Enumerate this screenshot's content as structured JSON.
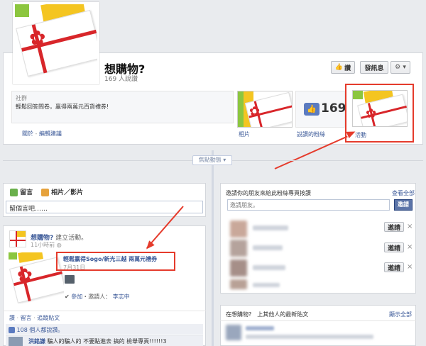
{
  "page": {
    "name": "想購物?",
    "likes_text": "169 人說讚",
    "category": "社群",
    "description": "輕鬆回答問卷，贏得兩萬元百貨禮券!",
    "about_link": "關於",
    "edit_link": "編輯建議",
    "separator": " - "
  },
  "header_buttons": {
    "like": "讚",
    "message": "發訊息",
    "gear": "⚙ ▾"
  },
  "app_tabs": {
    "photos": "相片",
    "likes_count": "169",
    "likes_label": "說讚的粉絲",
    "events": "活動"
  },
  "timeline_menu": {
    "label": "焦點動態 ▾"
  },
  "composer": {
    "tab_post": "留言",
    "tab_photo": "相片／影片",
    "placeholder": "留個言吧……"
  },
  "post": {
    "author": "想購物?",
    "action": "建立活動。",
    "time": "11小時前",
    "event_title": "輕鬆贏得Sogo/新光三越 兩萬元禮券",
    "event_date": "7月31日",
    "join": "參加",
    "invited_by": "・邀請人：",
    "inviter": "李志中",
    "actions": [
      "讚",
      "留言",
      "追蹤貼文"
    ],
    "actions_sep": " · ",
    "like_count": "108 個人都說讚。",
    "comment_author": "洪銘謙",
    "comment_text": "騙人的騙人的 不要點進去 搞的 檢舉專頁!!!!!!3"
  },
  "invite": {
    "title": "邀請你的朋友來給此粉絲專頁按讚",
    "see_all": "查看全部",
    "search_placeholder": "邀請朋友。",
    "search_button": "邀請",
    "invite_button": "邀請",
    "close_glyph": "×"
  },
  "recent": {
    "title": "在想購物?　上其他人的最新貼文",
    "see_all": "顯示全部"
  }
}
